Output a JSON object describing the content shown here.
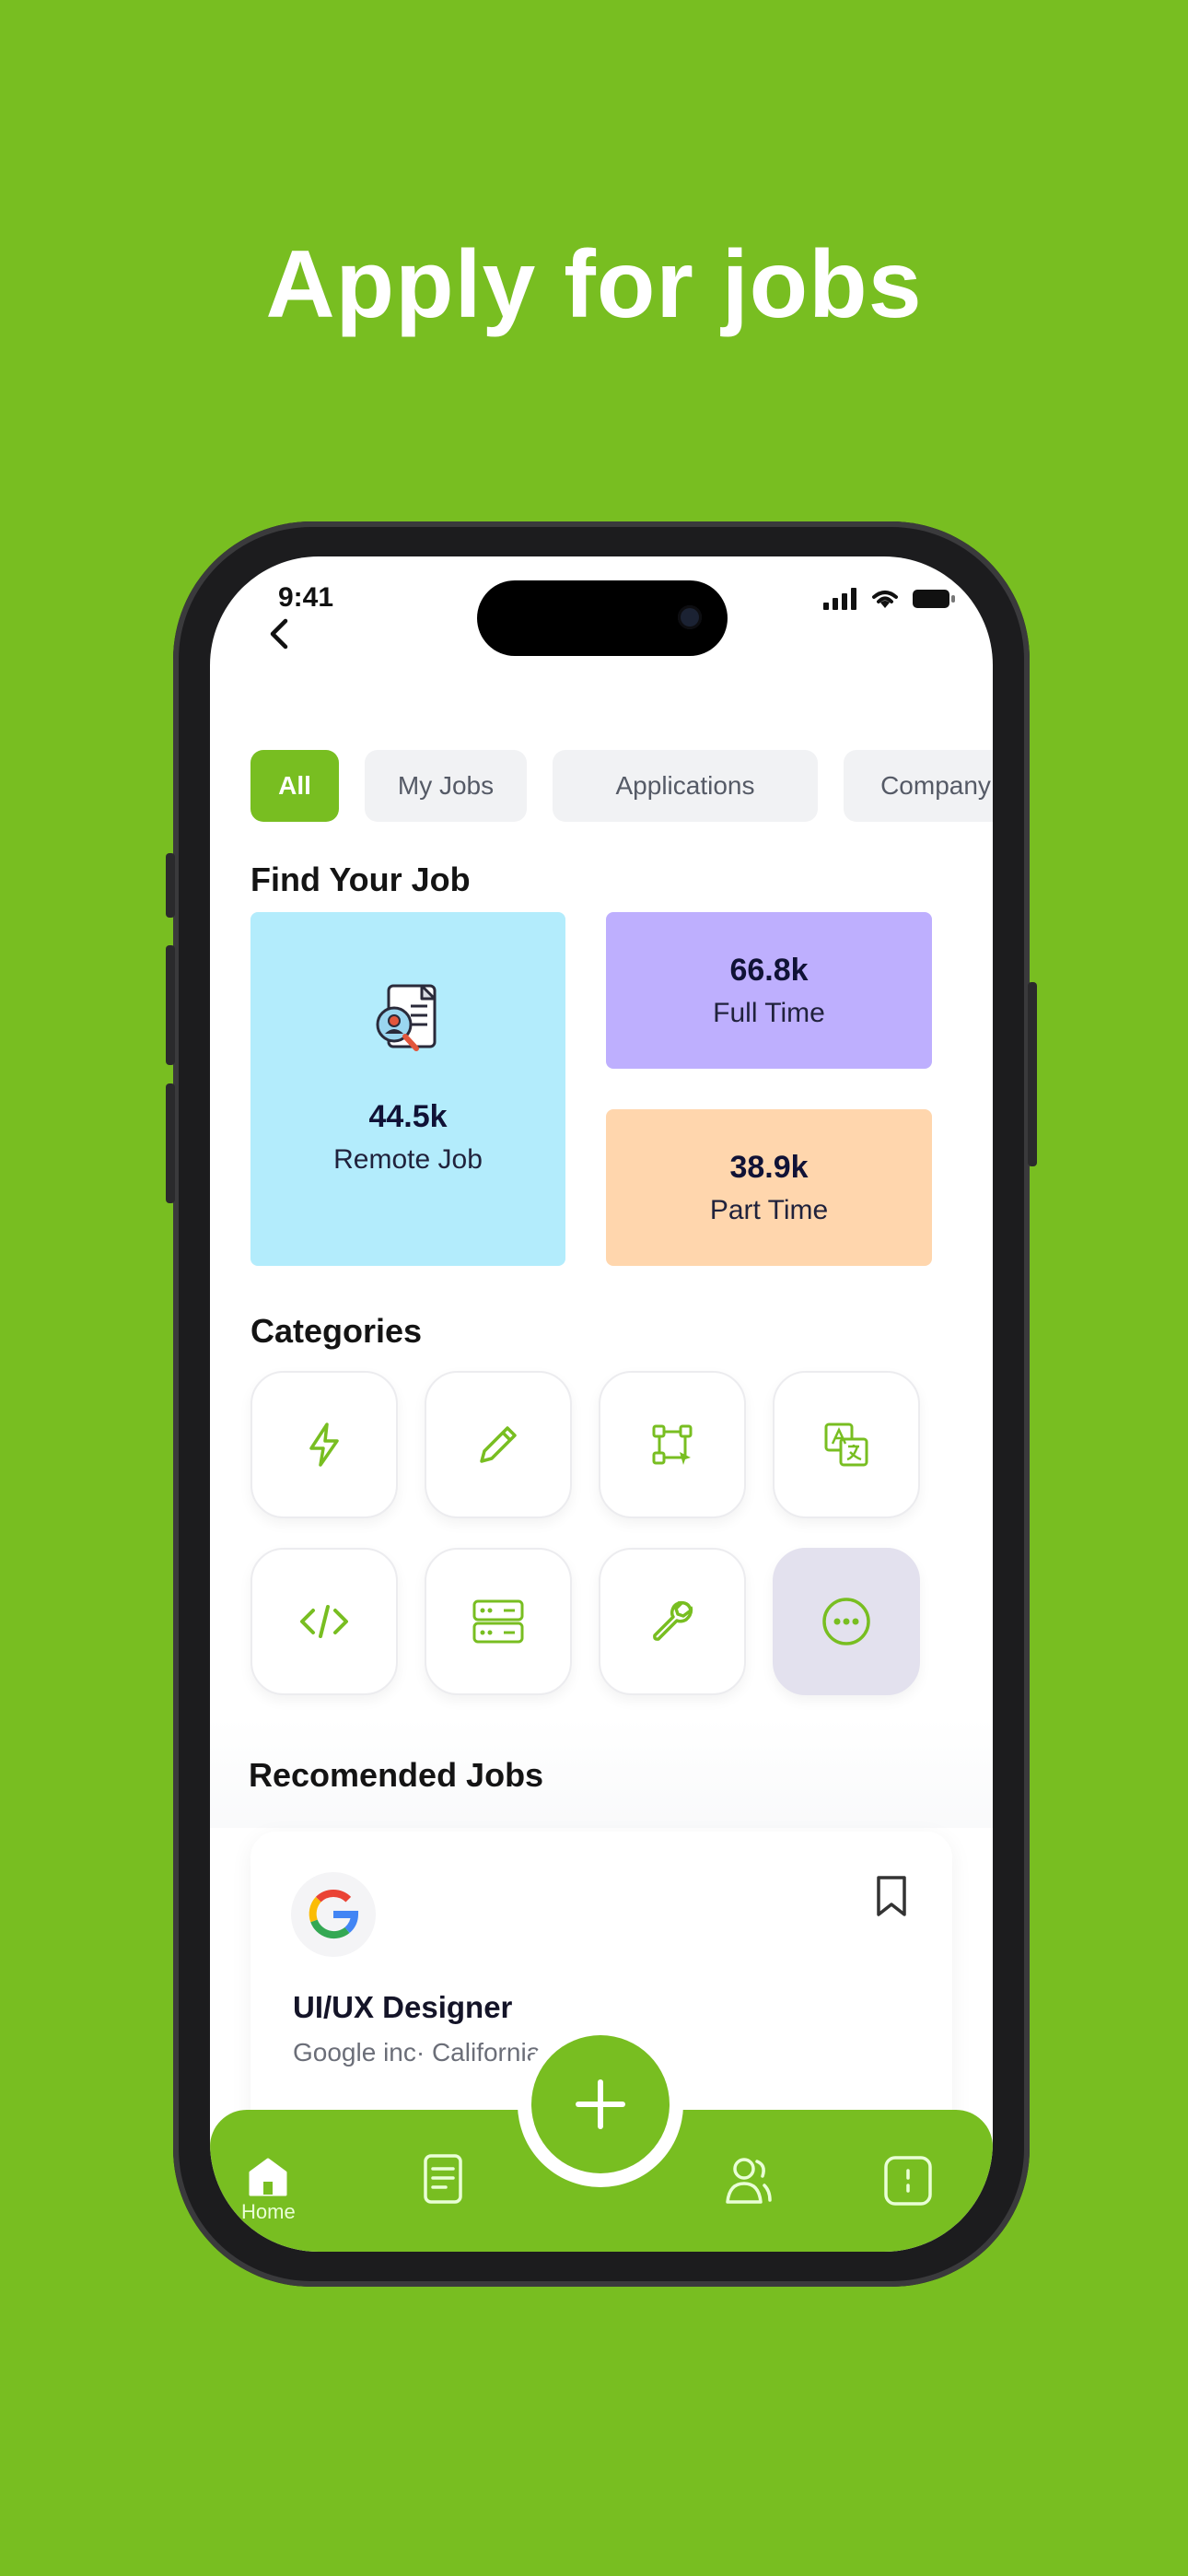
{
  "headline": "Apply for jobs",
  "status": {
    "time": "9:41"
  },
  "tabs": [
    {
      "label": "All",
      "active": true
    },
    {
      "label": "My Jobs",
      "active": false
    },
    {
      "label": "Applications",
      "active": false
    },
    {
      "label": "Company",
      "active": false
    }
  ],
  "find_section": {
    "title": "Find Your Job",
    "remote": {
      "value": "44.5k",
      "label": "Remote Job",
      "color": "#B3ECFC"
    },
    "full_time": {
      "value": "66.8k",
      "label": "Full Time",
      "color": "#BEAFFE"
    },
    "part_time": {
      "value": "38.9k",
      "label": "Part Time",
      "color": "#FFD6AD"
    }
  },
  "categories": {
    "title": "Categories",
    "icons": [
      "lightning-icon",
      "pencil-icon",
      "vector-crop-icon",
      "translate-icon",
      "code-icon",
      "server-icon",
      "wrench-icon",
      "more-icon"
    ]
  },
  "recommended": {
    "title": "Recomended Jobs",
    "job": {
      "title": "UI/UX Designer",
      "meta": "Google inc· California"
    }
  },
  "nav": {
    "home_label": "Home"
  },
  "colors": {
    "accent": "#78BE21",
    "background": "#78BE21"
  }
}
